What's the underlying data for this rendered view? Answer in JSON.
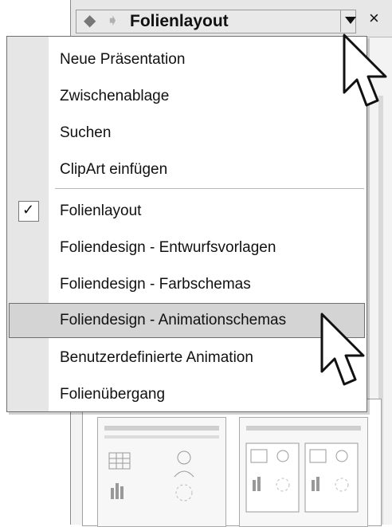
{
  "taskpane": {
    "title": "Folienlayout",
    "close_glyph": "×",
    "back_icon": "back-arrow-icon",
    "forward_icon": "forward-arrow-icon",
    "dropdown_icon": "triangle-down-icon"
  },
  "menu": {
    "items": [
      {
        "label": "Neue Präsentation"
      },
      {
        "label": "Zwischenablage"
      },
      {
        "label": "Suchen"
      },
      {
        "label": "ClipArt einfügen"
      },
      {
        "label": "Folienlayout",
        "checked": true
      },
      {
        "label": "Foliendesign - Entwurfsvorlagen"
      },
      {
        "label": "Foliendesign - Farbschemas"
      },
      {
        "label": "Foliendesign - Animationschemas",
        "highlighted": true
      },
      {
        "label": "Benutzerdefinierte Animation"
      },
      {
        "label": "Folienübergang"
      }
    ]
  },
  "colors": {
    "menu_strip": "#e6e6e6",
    "highlight": "#d4d4d4",
    "border": "#6f6f6f"
  }
}
